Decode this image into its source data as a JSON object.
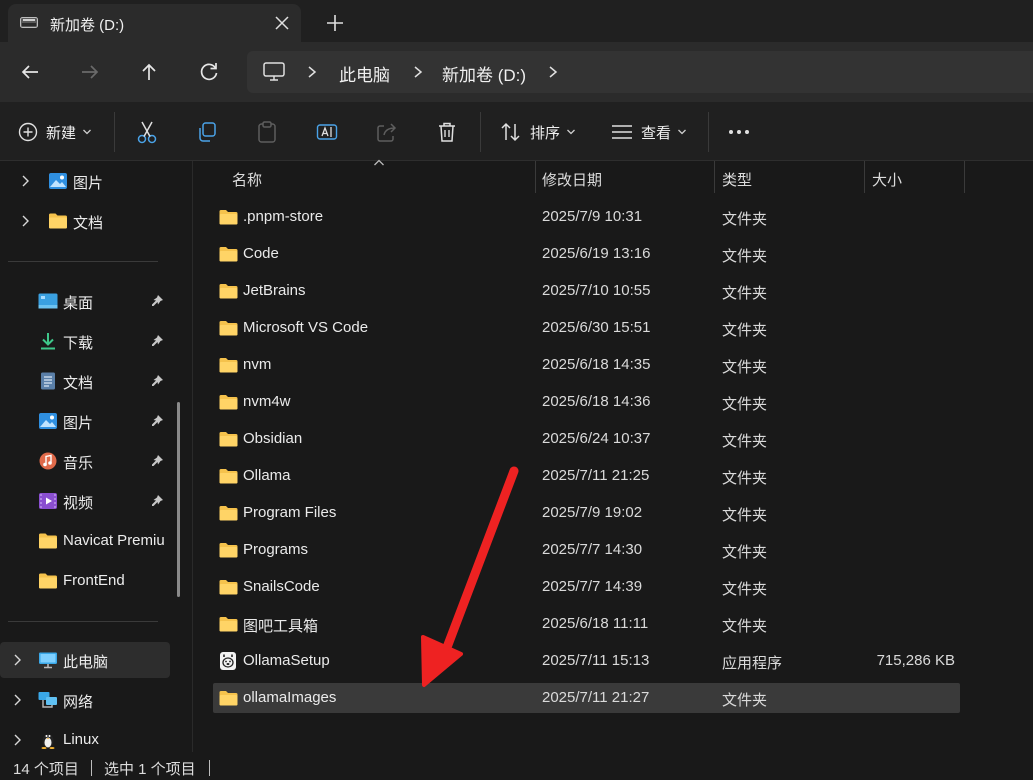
{
  "tab": {
    "title": "新加卷 (D:)"
  },
  "breadcrumb": [
    "此电脑",
    "新加卷 (D:)"
  ],
  "toolbar": {
    "new_label": "新建",
    "sort_label": "排序",
    "view_label": "查看"
  },
  "sidebar": {
    "top_items": [
      {
        "label": "图片",
        "icon": "pictures-icon"
      },
      {
        "label": "文档",
        "icon": "folder-icon"
      }
    ],
    "pinned_items": [
      {
        "label": "桌面",
        "icon": "desktop-icon",
        "pinned": true
      },
      {
        "label": "下载",
        "icon": "download-icon",
        "pinned": true
      },
      {
        "label": "文档",
        "icon": "documents-icon",
        "pinned": true
      },
      {
        "label": "图片",
        "icon": "pictures-icon",
        "pinned": true
      },
      {
        "label": "音乐",
        "icon": "music-icon",
        "pinned": true
      },
      {
        "label": "视频",
        "icon": "video-icon",
        "pinned": true
      },
      {
        "label": "Navicat Premiu",
        "icon": "folder-icon",
        "pinned": false
      },
      {
        "label": "FrontEnd",
        "icon": "folder-icon",
        "pinned": false
      }
    ],
    "bottom_items": [
      {
        "label": "此电脑",
        "icon": "this-pc-icon",
        "selected": true
      },
      {
        "label": "网络",
        "icon": "network-icon",
        "selected": false
      },
      {
        "label": "Linux",
        "icon": "linux-icon",
        "selected": false
      }
    ]
  },
  "columns": {
    "name": "名称",
    "date": "修改日期",
    "type": "类型",
    "size": "大小"
  },
  "files": [
    {
      "name": ".pnpm-store",
      "date": "2025/7/9 10:31",
      "type": "文件夹",
      "size": "",
      "icon": "folder-icon"
    },
    {
      "name": "Code",
      "date": "2025/6/19 13:16",
      "type": "文件夹",
      "size": "",
      "icon": "folder-icon"
    },
    {
      "name": "JetBrains",
      "date": "2025/7/10 10:55",
      "type": "文件夹",
      "size": "",
      "icon": "folder-icon"
    },
    {
      "name": "Microsoft VS Code",
      "date": "2025/6/30 15:51",
      "type": "文件夹",
      "size": "",
      "icon": "folder-icon"
    },
    {
      "name": "nvm",
      "date": "2025/6/18 14:35",
      "type": "文件夹",
      "size": "",
      "icon": "folder-icon"
    },
    {
      "name": "nvm4w",
      "date": "2025/6/18 14:36",
      "type": "文件夹",
      "size": "",
      "icon": "folder-icon"
    },
    {
      "name": "Obsidian",
      "date": "2025/6/24 10:37",
      "type": "文件夹",
      "size": "",
      "icon": "folder-icon"
    },
    {
      "name": "Ollama",
      "date": "2025/7/11 21:25",
      "type": "文件夹",
      "size": "",
      "icon": "folder-icon"
    },
    {
      "name": "Program Files",
      "date": "2025/7/9 19:02",
      "type": "文件夹",
      "size": "",
      "icon": "folder-icon"
    },
    {
      "name": "Programs",
      "date": "2025/7/7 14:30",
      "type": "文件夹",
      "size": "",
      "icon": "folder-icon"
    },
    {
      "name": "SnailsCode",
      "date": "2025/7/7 14:39",
      "type": "文件夹",
      "size": "",
      "icon": "folder-icon"
    },
    {
      "name": "图吧工具箱",
      "date": "2025/6/18 11:11",
      "type": "文件夹",
      "size": "",
      "icon": "folder-icon"
    },
    {
      "name": "OllamaSetup",
      "date": "2025/7/11 15:13",
      "type": "应用程序",
      "size": "715,286 KB",
      "icon": "ollama-app-icon"
    },
    {
      "name": "ollamaImages",
      "date": "2025/7/11 21:27",
      "type": "文件夹",
      "size": "",
      "icon": "folder-icon",
      "selected": true
    }
  ],
  "status": {
    "item_count": "14 个项目",
    "selected_count": "选中 1 个项目"
  },
  "colors": {
    "folder": "#f5c24c",
    "arrow": "#ee2222",
    "background": "#191919"
  }
}
